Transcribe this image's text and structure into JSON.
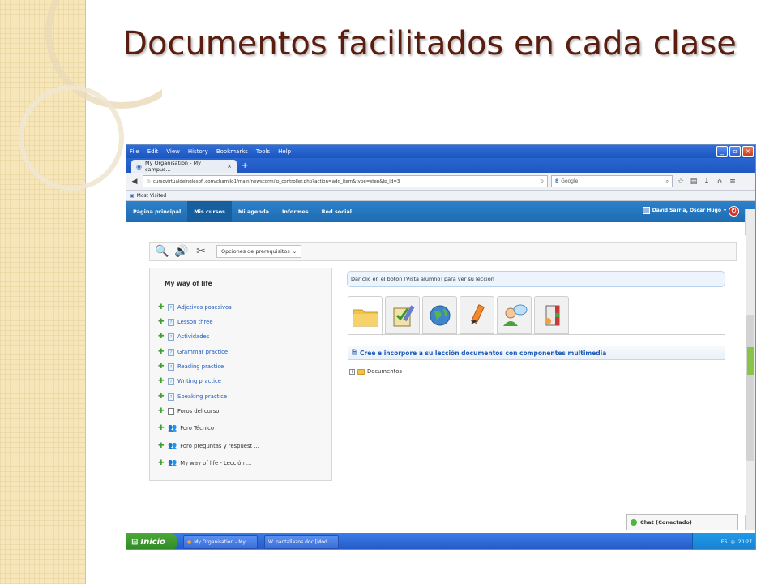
{
  "slide": {
    "title": "Documentos facilitados en cada clase",
    "colors": {
      "title": "#5a1e10",
      "side_band": "#f7e6b9",
      "site_nav": "#2d82c9"
    }
  },
  "browser": {
    "menu": [
      "File",
      "Edit",
      "View",
      "History",
      "Bookmarks",
      "Tools",
      "Help"
    ],
    "tab_title": "My Organisation - My campus...",
    "tab_close": "×",
    "new_tab": "+",
    "url": "cursovirtualdeinglesbfi.com/chamilo1/main/newscorm/lp_controller.php?action=add_item&type=step&lp_id=3",
    "search_placeholder": "Google",
    "bookmarks_label": "Most Visited"
  },
  "site_nav": {
    "items": [
      "Página principal",
      "Mis cursos",
      "Mi agenda",
      "Informes",
      "Red social"
    ],
    "active_index": 1,
    "user": "David Sarria, Oscar Hugo"
  },
  "toolbar": {
    "prereq_label": "Opciones de prerequisitos"
  },
  "lesson": {
    "title": "My way of life",
    "items": [
      {
        "label": "Adjetivos posesivos",
        "kind": "doc"
      },
      {
        "label": "Lesson three",
        "kind": "doc"
      },
      {
        "label": "Actividades",
        "kind": "doc"
      },
      {
        "label": "Grammar practice",
        "kind": "doc"
      },
      {
        "label": "Reading practice",
        "kind": "doc"
      },
      {
        "label": "Writing practice",
        "kind": "doc"
      },
      {
        "label": "Speaking practice",
        "kind": "doc"
      },
      {
        "label": "Foros del curso",
        "kind": "book"
      },
      {
        "label": "Foro Técnico",
        "kind": "forum"
      },
      {
        "label": "Foro preguntas y respuest ...",
        "kind": "forum"
      },
      {
        "label": "My way of life - Lección ...",
        "kind": "forum"
      }
    ]
  },
  "main": {
    "info": "Dar clic en el botón [Vista alumno] para ver su lección",
    "tool_tabs": [
      "folder-icon",
      "checklist-icon",
      "globe-icon",
      "pencil-icon",
      "user-chat-icon",
      "book-gear-icon"
    ],
    "section_title": "Cree e incorpore a su lección documentos con componentes multimedia",
    "tree_root": "Documentos"
  },
  "chat": {
    "label": "Chat (Conectado)"
  },
  "taskbar": {
    "start": "Inicio",
    "tasks": [
      "My Organisation - My...",
      "pantallazos.doc [Mod..."
    ],
    "lang": "ES",
    "time": "20:27"
  }
}
